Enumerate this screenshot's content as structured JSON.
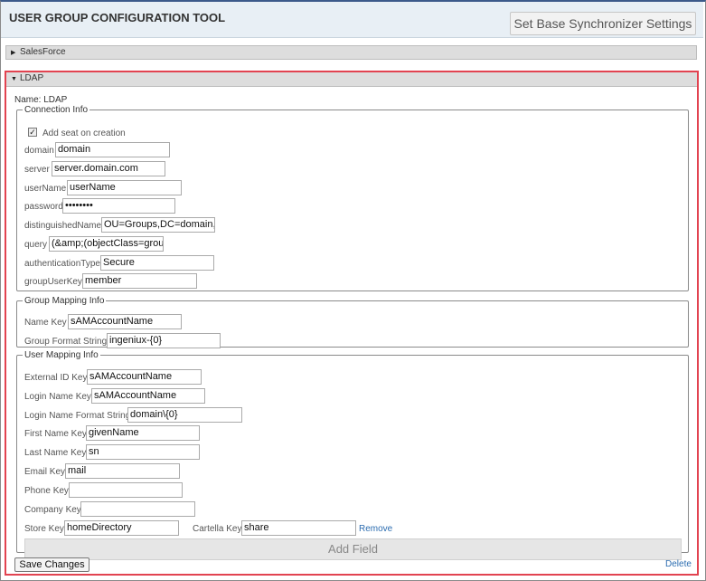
{
  "header": {
    "title": "USER GROUP CONFIGURATION TOOL",
    "base_sync_button": "Set Base Synchronizer Settings"
  },
  "salesforce": {
    "label": "SalesForce",
    "expanded": false
  },
  "ldap": {
    "label": "LDAP",
    "expanded": true,
    "name_line": "Name: LDAP",
    "connection": {
      "legend": "Connection Info",
      "add_seat_label": "Add seat on creation",
      "add_seat_checked": true,
      "domain_label": "domain",
      "domain_value": "domain",
      "server_label": "server",
      "server_value": "server.domain.com",
      "username_label": "userName",
      "username_value": "userName",
      "password_label": "password",
      "password_value": "••••••••",
      "dn_label": "distinguishedName",
      "dn_value": "OU=Groups,DC=domain,D",
      "query_label": "query",
      "query_value": "(&amp;(objectClass=group",
      "auth_label": "authenticationType",
      "auth_value": "Secure",
      "groupuserkey_label": "groupUserKey",
      "groupuserkey_value": "member"
    },
    "group_mapping": {
      "legend": "Group Mapping Info",
      "name_key_label": "Name Key",
      "name_key_value": "sAMAccountName",
      "format_label": "Group Format String",
      "format_value": "ingeniux-{0}"
    },
    "user_mapping": {
      "legend": "User Mapping Info",
      "external_id_label": "External ID Key",
      "external_id_value": "sAMAccountName",
      "login_name_label": "Login Name Key",
      "login_name_value": "sAMAccountName",
      "login_format_label": "Login Name Format String",
      "login_format_value": "domain\\{0}",
      "first_name_label": "First Name Key",
      "first_name_value": "givenName",
      "last_name_label": "Last Name Key",
      "last_name_value": "sn",
      "email_label": "Email Key",
      "email_value": "mail",
      "phone_label": "Phone Key",
      "phone_value": "",
      "company_label": "Company Key",
      "company_value": "",
      "store_label": "Store Key",
      "store_value": "homeDirectory",
      "cartella_label": "Cartella Key",
      "cartella_value": "share",
      "remove_label": "Remove",
      "add_field_label": "Add Field"
    },
    "save_label": "Save Changes",
    "delete_label": "Delete"
  }
}
